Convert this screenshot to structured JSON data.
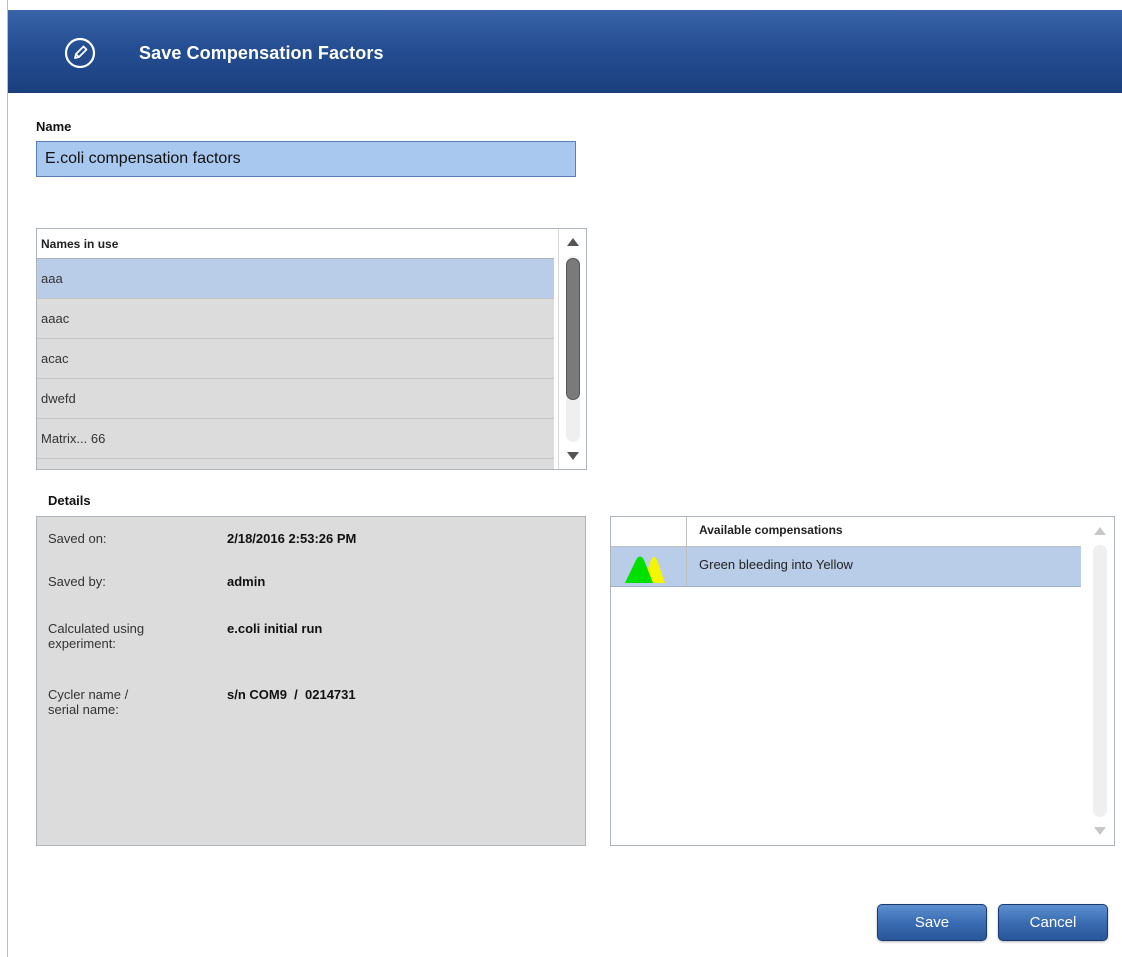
{
  "dialog": {
    "title": "Save Compensation Factors",
    "title_icon": "pencil-icon"
  },
  "name_field": {
    "label": "Name",
    "value": "E.coli compensation factors"
  },
  "names_in_use": {
    "header": "Names in use",
    "items": [
      "aaa",
      "aaac",
      "acac",
      "dwefd",
      "Matrix... 66"
    ],
    "selected_index": 0
  },
  "details": {
    "heading": "Details",
    "saved_on_label": "Saved on:",
    "saved_on_value": "2/18/2016 2:53:26 PM",
    "saved_by_label": "Saved by:",
    "saved_by_value": "admin",
    "calculated_label_line1": "Calculated using",
    "calculated_label_line2": "experiment:",
    "calculated_value": "e.coli initial run",
    "cycler_label_line1": "Cycler name /",
    "cycler_label_line2": "serial name:",
    "cycler_value": "s/n COM9  /  0214731"
  },
  "compensations": {
    "header": "Available compensations",
    "rows": [
      {
        "icon": "green-yellow-peaks-icon",
        "label": "Green bleeding into Yellow",
        "colors": [
          "#00e000",
          "#f5f500"
        ]
      }
    ]
  },
  "buttons": {
    "save": "Save",
    "cancel": "Cancel"
  },
  "colors": {
    "title_bar": "#254e93",
    "selection": "#b9cde8",
    "input_bg": "#a9c8ef",
    "details_bg": "#dcdcdc"
  }
}
